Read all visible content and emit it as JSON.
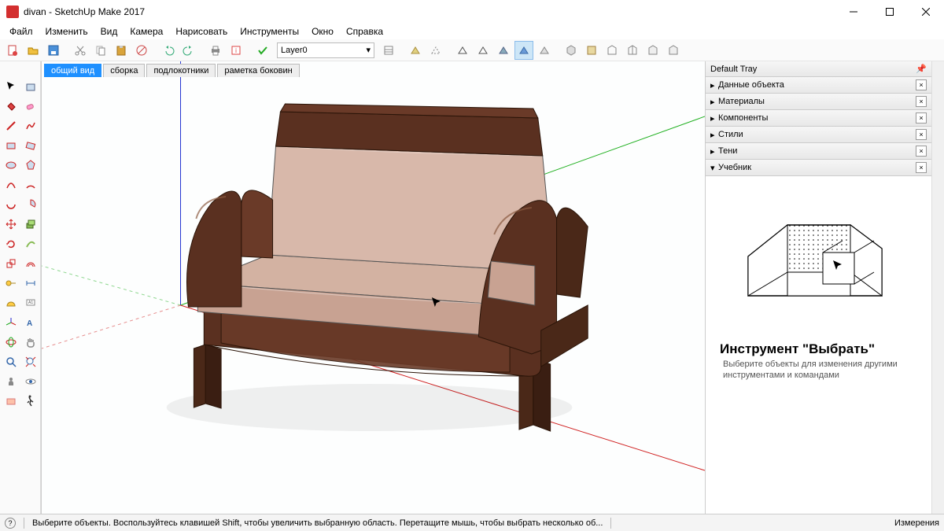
{
  "title": "divan - SketchUp Make 2017",
  "menu": [
    "Файл",
    "Изменить",
    "Вид",
    "Камера",
    "Нарисовать",
    "Инструменты",
    "Окно",
    "Справка"
  ],
  "layer_selected": "Layer0",
  "scene_tabs": [
    {
      "label": "общий вид",
      "active": true
    },
    {
      "label": "сборка",
      "active": false
    },
    {
      "label": "подлокотники",
      "active": false
    },
    {
      "label": "раметка боковин",
      "active": false
    }
  ],
  "tray": {
    "title": "Default Tray",
    "panels": [
      {
        "label": "Данные объекта",
        "open": false
      },
      {
        "label": "Материалы",
        "open": false
      },
      {
        "label": "Компоненты",
        "open": false
      },
      {
        "label": "Стили",
        "open": false
      },
      {
        "label": "Тени",
        "open": false
      },
      {
        "label": "Учебник",
        "open": true
      }
    ],
    "instructor": {
      "heading": "Инструмент \"Выбрать\"",
      "text": "Выберите объекты для изменения другими инструментами и командами"
    }
  },
  "status": {
    "hint": "Выберите объекты. Воспользуйтесь клавишей Shift, чтобы увеличить выбранную область. Перетащите мышь, чтобы выбрать несколько об...",
    "measure_label": "Измерения"
  }
}
